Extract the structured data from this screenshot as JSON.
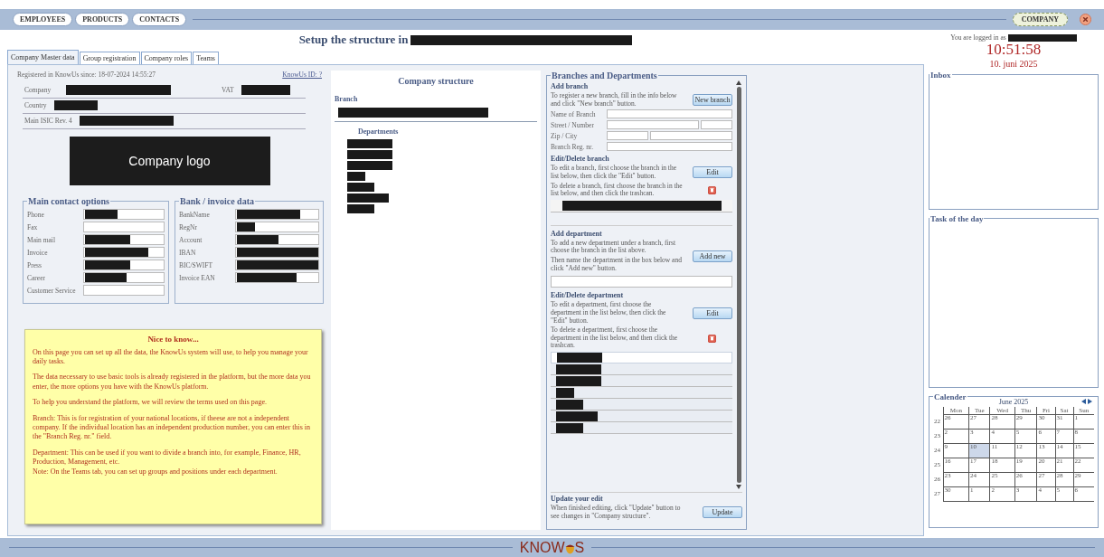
{
  "top_nav": {
    "tabs": [
      {
        "label": "EMPLOYEES"
      },
      {
        "label": "PRODUCTS"
      },
      {
        "label": "CONTACTS"
      }
    ],
    "company_button": "COMPANY"
  },
  "header": {
    "title": "Setup the structure in",
    "logged_in": "You are logged in as",
    "time": "10:51:58",
    "date": "10. juni 2025"
  },
  "tabs": [
    {
      "label": "Company Master data",
      "selected": true
    },
    {
      "label": "Group registration",
      "selected": false
    },
    {
      "label": "Company roles",
      "selected": false
    },
    {
      "label": "Teams",
      "selected": false
    }
  ],
  "master": {
    "registered": "Registered in KnowUs since: 18-07-2024 14:55:27",
    "id_link": "KnowUs ID: ?",
    "rows": [
      {
        "label": "Company",
        "extra_label": "VAT"
      },
      {
        "label": "Country"
      },
      {
        "label": "Main ISIC Rev. 4"
      }
    ],
    "logo_text": "Company logo"
  },
  "contact": {
    "title": "Main contact options",
    "fields": [
      {
        "label": "Phone",
        "redacted": true
      },
      {
        "label": "Fax",
        "redacted": false
      },
      {
        "label": "Main mail",
        "redacted": true
      },
      {
        "label": "Invoice",
        "redacted": true
      },
      {
        "label": "Press",
        "redacted": true
      },
      {
        "label": "Career",
        "redacted": true
      },
      {
        "label": "Customer Service",
        "redacted": false
      }
    ]
  },
  "bank": {
    "title": "Bank / invoice data",
    "fields": [
      {
        "label": "BankName",
        "redacted": true
      },
      {
        "label": "RegNr",
        "redacted": true
      },
      {
        "label": "Account",
        "redacted": true
      },
      {
        "label": "IBAN",
        "redacted": true
      },
      {
        "label": "BIC/SWIFT",
        "redacted": true
      },
      {
        "label": "Invoice EAN",
        "redacted": true
      }
    ]
  },
  "note": {
    "title": "Nice to know...",
    "paragraphs": [
      "On this page you can set up all the data, the KnowUs system will use, to help you manage your daily tasks.",
      "The data necessary to use basic tools is already registered in the platform, but the more data you enter, the more options you have with the KnowUs platform.",
      "To help you understand the platform, we will review the terms used on this page.",
      "Branch: This is for registration of your national locations, if theese are not a independent company. If the individual location has an independent production number, you can enter this in the \"Branch Reg. nr.\" field.",
      "Department: This can be used if you want to divide a branch into, for example, Finance, HR, Production, Management, etc.\nNote: On the Teams tab, you can set up groups and positions under each department."
    ]
  },
  "structure": {
    "title": "Company structure",
    "branch_label": "Branch",
    "departments_label": "Departments"
  },
  "branches": {
    "title": "Branches and Departments",
    "add_branch": {
      "heading": "Add branch",
      "text": "To register a new branch, fill in the info below and click \"New branch\" button.",
      "button": "New branch",
      "fields": [
        {
          "label": "Name of Branch",
          "kind": "single"
        },
        {
          "label": "Street / Number",
          "kind": "split-end"
        },
        {
          "label": "Zip / City",
          "kind": "split-start"
        },
        {
          "label": "Branch Reg. nr.",
          "kind": "single"
        }
      ]
    },
    "edit_branch": {
      "heading": "Edit/Delete branch",
      "edit_text": "To edit a branch, first choose the branch in the list below, then click the \"Edit\" button.",
      "edit_button": "Edit",
      "delete_text": "To delete a branch, first choose the branch in the list below, and then click the trashcan."
    },
    "add_department": {
      "heading": "Add department",
      "text1": "To add a new department under a branch, first choose the branch in the list above.",
      "text2": "Then name the department in the box below and click \"Add new\" button.",
      "button": "Add new"
    },
    "edit_department": {
      "heading": "Edit/Delete department",
      "edit_text": "To edit a department, first choose the department in the list below, then click the \"Edit\" button.",
      "edit_button": "Edit",
      "delete_text": "To delete a department, first choose the department in the list below, and then click the trashcan.",
      "items": [
        {
          "selected": true
        },
        {
          "selected": false
        },
        {
          "selected": false
        },
        {
          "selected": false
        },
        {
          "selected": false
        },
        {
          "selected": false
        },
        {
          "selected": false
        }
      ]
    },
    "update": {
      "heading": "Update your edit",
      "text": "When finished editing, click \"Update\" button to see changes in \"Company structure\".",
      "button": "Update"
    }
  },
  "inbox": {
    "title": "Inbox"
  },
  "task": {
    "title": "Task of the day"
  },
  "calendar": {
    "title": "Calender",
    "month": "June 2025",
    "weekdays": [
      "Mon",
      "Tue",
      "Wed",
      "Thu",
      "Fri",
      "Sat",
      "Sun"
    ],
    "weeks": [
      {
        "number": "22",
        "days": [
          {
            "day": "26",
            "selected": false
          },
          {
            "day": "27",
            "selected": false
          },
          {
            "day": "28",
            "selected": false
          },
          {
            "day": "29",
            "selected": false
          },
          {
            "day": "30",
            "selected": false
          },
          {
            "day": "31",
            "selected": false
          },
          {
            "day": "1",
            "selected": false
          }
        ]
      },
      {
        "number": "23",
        "days": [
          {
            "day": "2",
            "selected": false
          },
          {
            "day": "3",
            "selected": false
          },
          {
            "day": "4",
            "selected": false
          },
          {
            "day": "5",
            "selected": false
          },
          {
            "day": "6",
            "selected": false
          },
          {
            "day": "7",
            "selected": false
          },
          {
            "day": "8",
            "selected": false
          }
        ]
      },
      {
        "number": "24",
        "days": [
          {
            "day": "9",
            "selected": false
          },
          {
            "day": "10",
            "selected": true
          },
          {
            "day": "11",
            "selected": false
          },
          {
            "day": "12",
            "selected": false
          },
          {
            "day": "13",
            "selected": false
          },
          {
            "day": "14",
            "selected": false
          },
          {
            "day": "15",
            "selected": false
          }
        ]
      },
      {
        "number": "25",
        "days": [
          {
            "day": "16",
            "selected": false
          },
          {
            "day": "17",
            "selected": false
          },
          {
            "day": "18",
            "selected": false
          },
          {
            "day": "19",
            "selected": false
          },
          {
            "day": "20",
            "selected": false
          },
          {
            "day": "21",
            "selected": false
          },
          {
            "day": "22",
            "selected": false
          }
        ]
      },
      {
        "number": "26",
        "days": [
          {
            "day": "23",
            "selected": false
          },
          {
            "day": "24",
            "selected": false
          },
          {
            "day": "25",
            "selected": false
          },
          {
            "day": "26",
            "selected": false
          },
          {
            "day": "27",
            "selected": false
          },
          {
            "day": "28",
            "selected": false
          },
          {
            "day": "29",
            "selected": false
          }
        ]
      },
      {
        "number": "27",
        "days": [
          {
            "day": "30",
            "selected": false
          },
          {
            "day": "1",
            "selected": false
          },
          {
            "day": "2",
            "selected": false
          },
          {
            "day": "3",
            "selected": false
          },
          {
            "day": "4",
            "selected": false
          },
          {
            "day": "5",
            "selected": false
          },
          {
            "day": "6",
            "selected": false
          }
        ]
      }
    ]
  },
  "footer": {
    "logo_start": "KNOW",
    "logo_end": "S"
  }
}
